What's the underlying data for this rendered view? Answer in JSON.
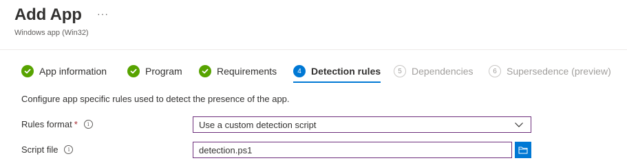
{
  "header": {
    "title": "Add App",
    "more_glyph": "···",
    "subtitle": "Windows app (Win32)"
  },
  "tabs": [
    {
      "label": "App information",
      "status": "complete",
      "icon": "checkmark-circle-icon"
    },
    {
      "label": "Program",
      "status": "complete",
      "icon": "checkmark-circle-icon"
    },
    {
      "label": "Requirements",
      "status": "complete",
      "icon": "checkmark-circle-icon"
    },
    {
      "label": "Detection rules",
      "status": "current",
      "number": "4"
    },
    {
      "label": "Dependencies",
      "status": "pending",
      "number": "5"
    },
    {
      "label": "Supersedence (preview)",
      "status": "pending",
      "number": "6"
    }
  ],
  "main": {
    "description": "Configure app specific rules used to detect the presence of the app.",
    "rules_format": {
      "label": "Rules format",
      "required_marker": "*",
      "info_glyph": "i",
      "value": "Use a custom detection script"
    },
    "script_file": {
      "label": "Script file",
      "info_glyph": "i",
      "value": "detection.ps1"
    }
  },
  "colors": {
    "accent": "#0078d4",
    "complete": "#57a300",
    "required": "#a4262c",
    "input_border": "#6b2c7a",
    "disabled_text": "#a19f9d"
  }
}
